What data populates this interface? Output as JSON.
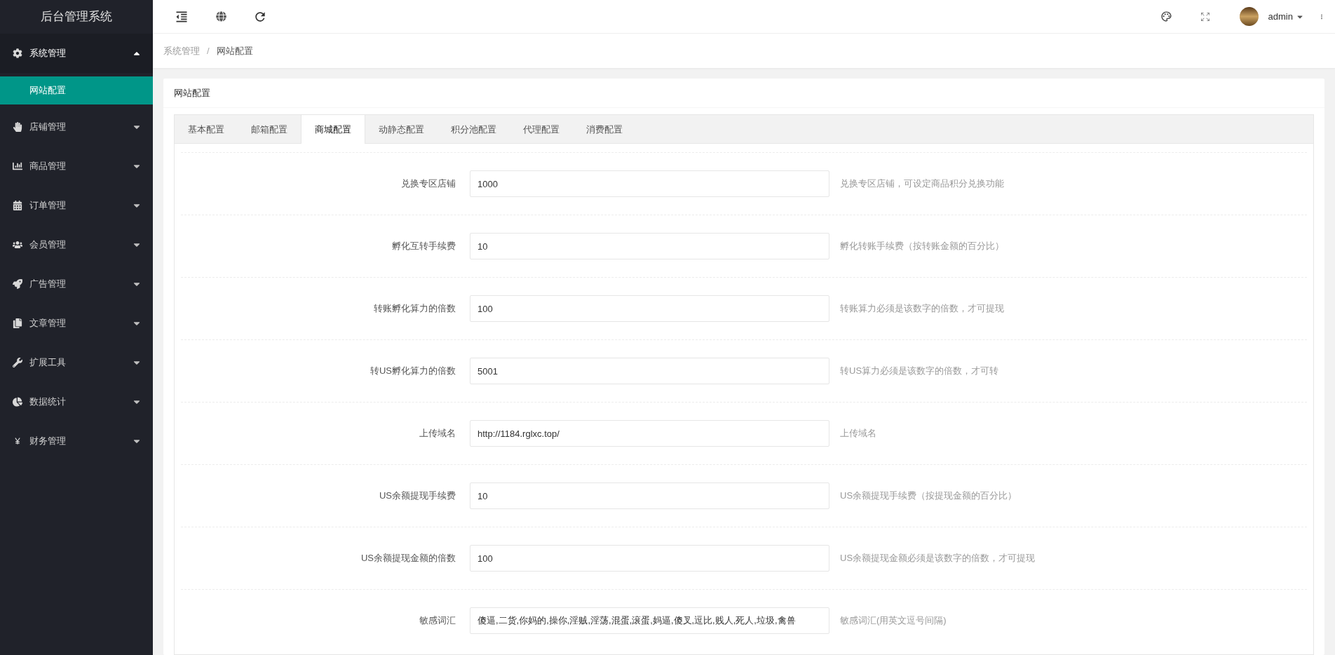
{
  "app_title": "后台管理系统",
  "sidebar": {
    "items": [
      {
        "label": "系统管理",
        "expanded": true,
        "children": [
          {
            "label": "网站配置",
            "selected": true
          }
        ]
      },
      {
        "label": "店铺管理",
        "expanded": false
      },
      {
        "label": "商品管理",
        "expanded": false
      },
      {
        "label": "订单管理",
        "expanded": false
      },
      {
        "label": "会员管理",
        "expanded": false
      },
      {
        "label": "广告管理",
        "expanded": false
      },
      {
        "label": "文章管理",
        "expanded": false
      },
      {
        "label": "扩展工具",
        "expanded": false
      },
      {
        "label": "数据统计",
        "expanded": false
      },
      {
        "label": "财务管理",
        "expanded": false
      }
    ]
  },
  "header": {
    "user": "admin"
  },
  "breadcrumb": {
    "items": [
      "系统管理",
      "网站配置"
    ],
    "separator": "/"
  },
  "card": {
    "title": "网站配置",
    "tabs": [
      {
        "label": "基本配置",
        "selected": false
      },
      {
        "label": "邮箱配置",
        "selected": false
      },
      {
        "label": "商城配置",
        "selected": true
      },
      {
        "label": "动静态配置",
        "selected": false
      },
      {
        "label": "积分池配置",
        "selected": false
      },
      {
        "label": "代理配置",
        "selected": false
      },
      {
        "label": "消费配置",
        "selected": false
      }
    ],
    "fields": [
      {
        "label": "兑换专区店铺",
        "value": "1000",
        "hint": "兑换专区店铺，可设定商品积分兑换功能"
      },
      {
        "label": "孵化互转手续费",
        "value": "10",
        "hint": "孵化转账手续费（按转账金额的百分比）"
      },
      {
        "label": "转账孵化算力的倍数",
        "value": "100",
        "hint": "转账算力必须是该数字的倍数，才可提现"
      },
      {
        "label": "转US孵化算力的倍数",
        "value": "5001",
        "hint": "转US算力必须是该数字的倍数，才可转"
      },
      {
        "label": "上传域名",
        "value": "http://1184.rglxc.top/",
        "hint": "上传域名"
      },
      {
        "label": "US余额提现手续费",
        "value": "10",
        "hint": "US余额提现手续费（按提现金额的百分比）"
      },
      {
        "label": "US余额提现金额的倍数",
        "value": "100",
        "hint": "US余额提现金额必须是该数字的倍数，才可提现"
      },
      {
        "label": "敏感词汇",
        "value": "傻逼,二货,你妈的,操你,淫贼,淫荡,混蛋,滚蛋,妈逼,傻叉,逗比,贱人,死人,垃圾,禽兽",
        "hint": "敏感词汇(用英文逗号间隔)"
      }
    ]
  }
}
